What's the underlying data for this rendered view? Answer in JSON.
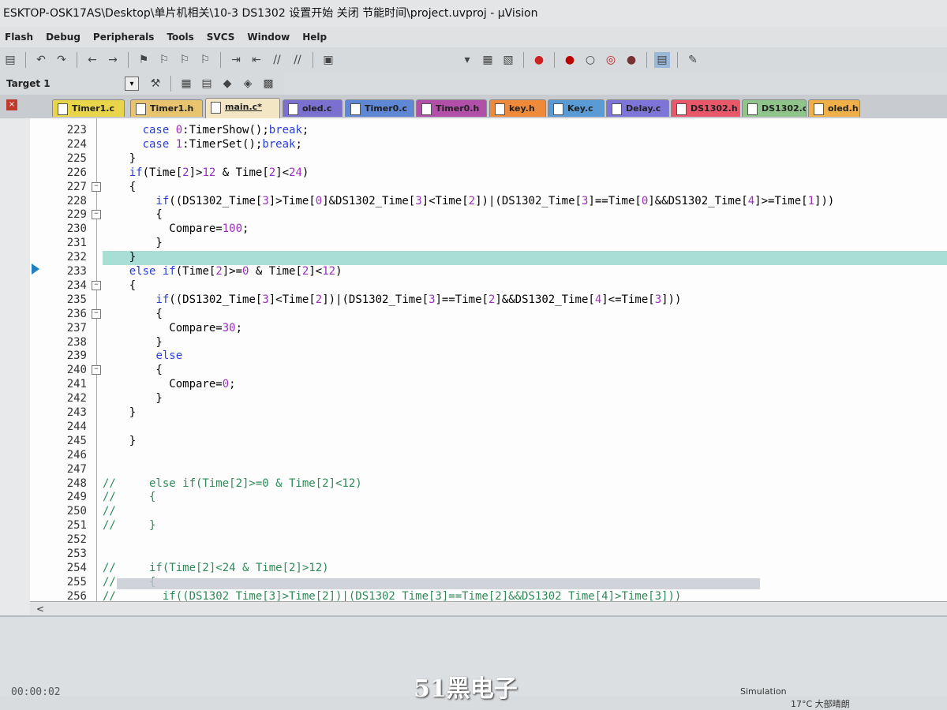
{
  "window": {
    "title": "ESKTOP-OSK17AS\\Desktop\\单片机相关\\10-3  DS1302  设置开始 关闭 节能时间\\project.uvproj - µVision"
  },
  "menu": [
    "Flash",
    "Debug",
    "Peripherals",
    "Tools",
    "SVCS",
    "Window",
    "Help"
  ],
  "target": {
    "label": "Target 1"
  },
  "tabs": [
    {
      "label": "Timer1.c",
      "color": "#e9d54a"
    },
    {
      "label": "Timer1.h",
      "color": "#e8c46f"
    },
    {
      "label": "main.c*",
      "color": "#e0c27a"
    },
    {
      "label": "oled.c",
      "color": "#7b6fd0"
    },
    {
      "label": "Timer0.c",
      "color": "#5e87d6"
    },
    {
      "label": "Timer0.h",
      "color": "#b24fa8"
    },
    {
      "label": "key.h",
      "color": "#ef8a3a"
    },
    {
      "label": "Key.c",
      "color": "#5a9bd6"
    },
    {
      "label": "Delay.c",
      "color": "#7e75d8"
    },
    {
      "label": "DS1302.h",
      "color": "#e8576a"
    },
    {
      "label": "DS1302.c",
      "color": "#8fc48a"
    },
    {
      "label": "oled.h",
      "color": "#efb04a"
    }
  ],
  "code_lines": [
    {
      "n": "223",
      "fold": false,
      "html": "      <span class='kw'>case</span> <span class='num'>0</span>:TimerShow();<span class='kw'>break</span>;"
    },
    {
      "n": "224",
      "fold": false,
      "html": "      <span class='kw'>case</span> <span class='num'>1</span>:TimerSet();<span class='kw'>break</span>;"
    },
    {
      "n": "225",
      "fold": false,
      "html": "    }"
    },
    {
      "n": "226",
      "fold": false,
      "html": "    <span class='kw'>if</span>(Time[<span class='num'>2</span>]&gt;<span class='num'>12</span> &amp; Time[<span class='num'>2</span>]&lt;<span class='num'>24</span>)"
    },
    {
      "n": "227",
      "fold": true,
      "html": "    {"
    },
    {
      "n": "228",
      "fold": false,
      "html": "        <span class='kw'>if</span>((DS1302_Time[<span class='num'>3</span>]&gt;Time[<span class='num'>0</span>]&amp;DS1302_Time[<span class='num'>3</span>]&lt;Time[<span class='num'>2</span>])|(DS1302_Time[<span class='num'>3</span>]==Time[<span class='num'>0</span>]&amp;&amp;DS1302_Time[<span class='num'>4</span>]&gt;=Time[<span class='num'>1</span>]))"
    },
    {
      "n": "229",
      "fold": true,
      "html": "        {"
    },
    {
      "n": "230",
      "fold": false,
      "html": "          Compare=<span class='num'>100</span>;"
    },
    {
      "n": "231",
      "fold": false,
      "html": "        }"
    },
    {
      "n": "232",
      "fold": false,
      "html": "    }"
    },
    {
      "n": "233",
      "fold": false,
      "html": "    <span class='kw'>else if</span>(Time[<span class='num'>2</span>]&gt;=<span class='num'>0</span> &amp; Time[<span class='num'>2</span>]&lt;<span class='num'>12</span>)"
    },
    {
      "n": "234",
      "fold": true,
      "html": "    {"
    },
    {
      "n": "235",
      "fold": false,
      "html": "        <span class='kw'>if</span>((DS1302_Time[<span class='num'>3</span>]&lt;Time[<span class='num'>2</span>])|(DS1302_Time[<span class='num'>3</span>]==Time[<span class='num'>2</span>]&amp;&amp;DS1302_Time[<span class='num'>4</span>]&lt;=Time[<span class='num'>3</span>]))"
    },
    {
      "n": "236",
      "fold": true,
      "html": "        {"
    },
    {
      "n": "237",
      "fold": false,
      "html": "          Compare=<span class='num'>30</span>;"
    },
    {
      "n": "238",
      "fold": false,
      "html": "        }"
    },
    {
      "n": "239",
      "fold": false,
      "html": "        <span class='kw'>else</span>"
    },
    {
      "n": "240",
      "fold": true,
      "html": "        {"
    },
    {
      "n": "241",
      "fold": false,
      "html": "          Compare=<span class='num'>0</span>;"
    },
    {
      "n": "242",
      "fold": false,
      "html": "        }"
    },
    {
      "n": "243",
      "fold": false,
      "html": "    }"
    },
    {
      "n": "244",
      "fold": false,
      "html": ""
    },
    {
      "n": "245",
      "fold": false,
      "html": "    }"
    },
    {
      "n": "246",
      "fold": false,
      "html": ""
    },
    {
      "n": "247",
      "fold": false,
      "html": ""
    },
    {
      "n": "248",
      "fold": false,
      "html": "<span class='cm'>//     else if(Time[2]&gt;=0 &amp; Time[2]&lt;12)</span>"
    },
    {
      "n": "249",
      "fold": false,
      "html": "<span class='cm'>//     {</span>"
    },
    {
      "n": "250",
      "fold": false,
      "html": "<span class='cm'>//</span>"
    },
    {
      "n": "251",
      "fold": false,
      "html": "<span class='cm'>//     }</span>"
    },
    {
      "n": "252",
      "fold": false,
      "html": ""
    },
    {
      "n": "253",
      "fold": false,
      "html": ""
    },
    {
      "n": "254",
      "fold": false,
      "html": "<span class='cm'>//     if(Time[2]&lt;24 &amp; Time[2]&gt;12)</span>"
    },
    {
      "n": "255",
      "fold": false,
      "html": "<span class='cm'>//     {</span>"
    },
    {
      "n": "256",
      "fold": false,
      "html": "<span class='cm'>//       if((DS1302_Time[3]&gt;Time[2])|(DS1302_Time[3]==Time[2]&amp;&amp;DS1302_Time[4]&gt;Time[3]))</span>"
    }
  ],
  "output": {
    "clock": "00:00:02"
  },
  "status": {
    "mode": "Simulation",
    "tray": "17°C  大部晴朗"
  },
  "watermark": "51黑电子"
}
